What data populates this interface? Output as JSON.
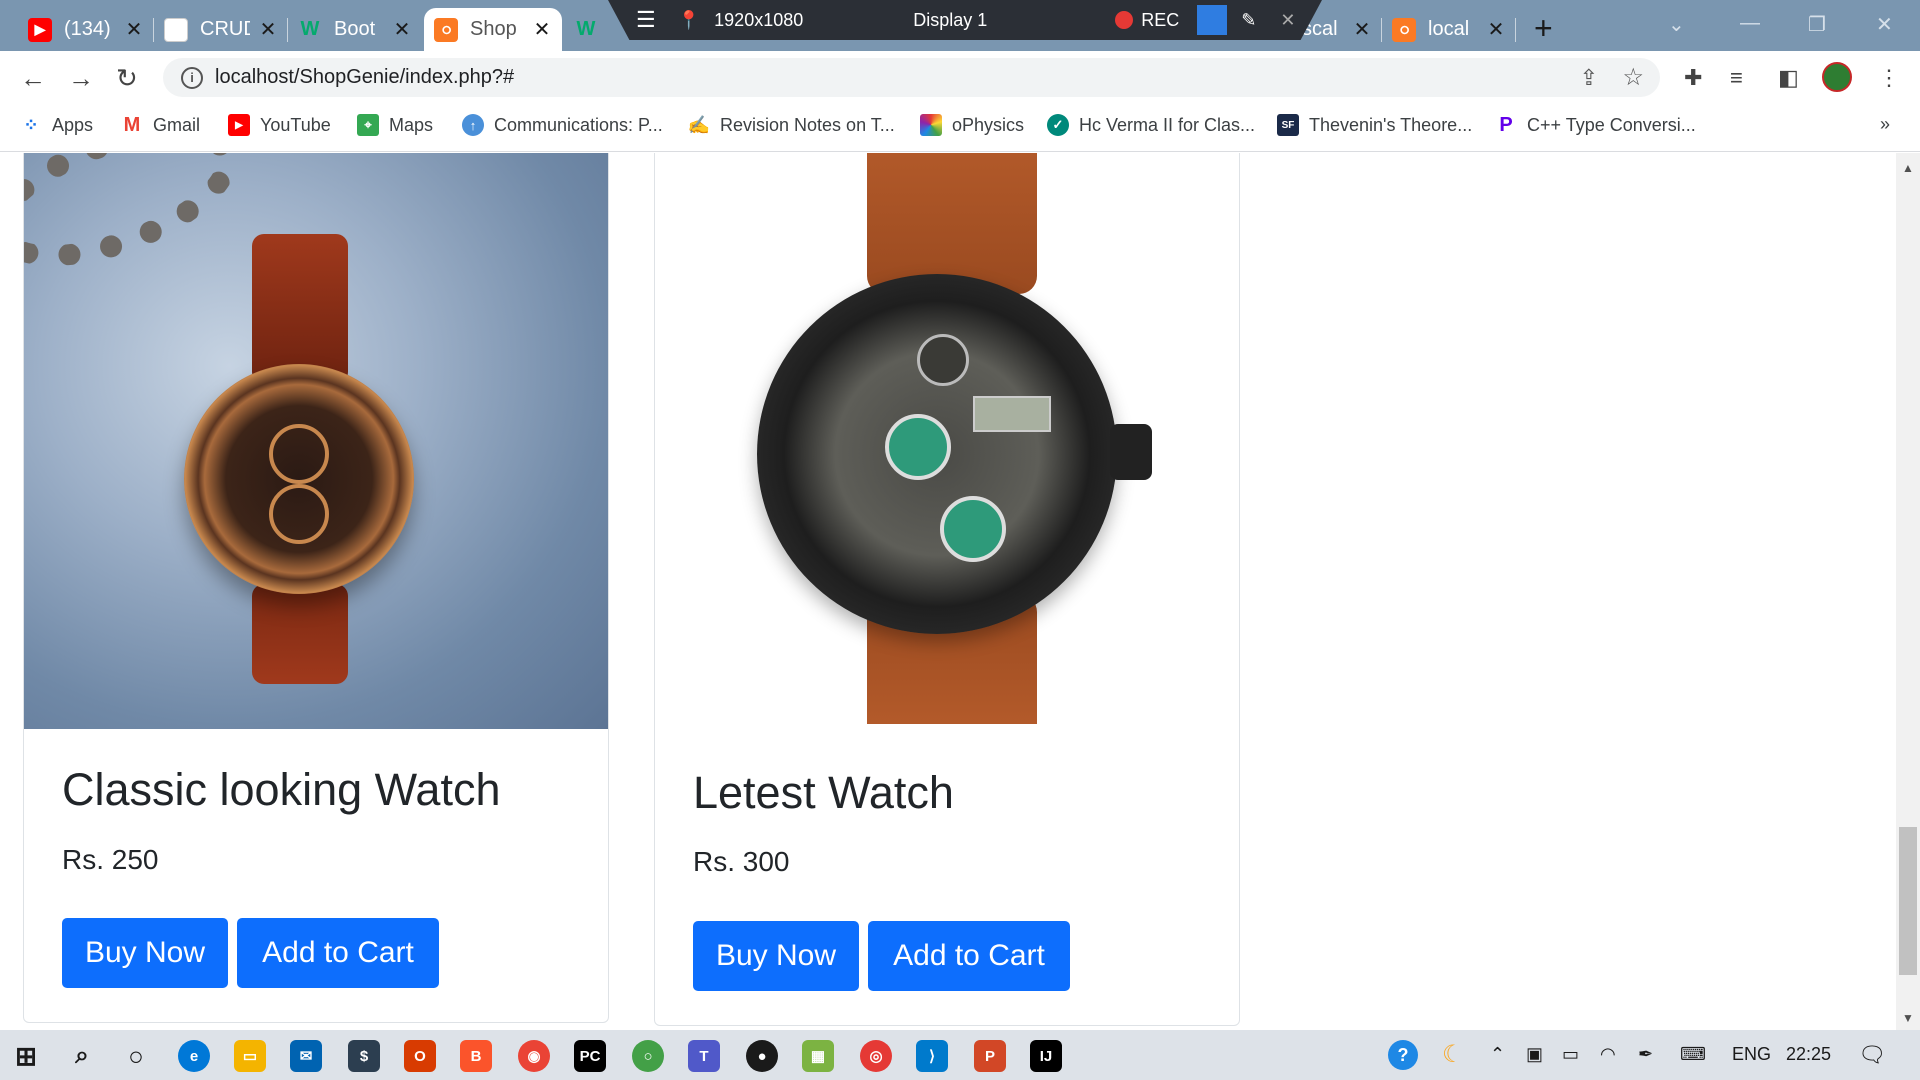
{
  "tabs": [
    {
      "title": "(134)",
      "icon": "youtube-icon",
      "color": "#ff0000"
    },
    {
      "title": "CRUD",
      "icon": "page-icon",
      "color": "#ffffff"
    },
    {
      "title": "Boot",
      "icon": "w3schools-icon",
      "color": "#04aa6d"
    },
    {
      "title": "Shop",
      "icon": "xampp-icon",
      "color": "#fb7a24",
      "active": true
    },
    {
      "title": "W",
      "icon": "w3schools-icon",
      "color": "#04aa6d"
    },
    {
      "title": "scal",
      "icon": "page-icon",
      "color": "#7a96b0"
    },
    {
      "title": "local",
      "icon": "xampp-icon",
      "color": "#fb7a24"
    }
  ],
  "recorder": {
    "resolution": "1920x1080",
    "display": "Display 1",
    "rec_label": "REC"
  },
  "toolbar": {
    "url": "localhost/ShopGenie/index.php?#"
  },
  "bookmarks": [
    {
      "label": "Apps",
      "icon": "apps-grid-icon",
      "color": "#1a73e8"
    },
    {
      "label": "Gmail",
      "icon": "gmail-icon",
      "color": "#ea4335"
    },
    {
      "label": "YouTube",
      "icon": "youtube-icon",
      "color": "#ff0000"
    },
    {
      "label": "Maps",
      "icon": "maps-icon",
      "color": "#34a853"
    },
    {
      "label": "Communications: P...",
      "icon": "upload-icon",
      "color": "#4a90d9"
    },
    {
      "label": "Revision Notes on T...",
      "icon": "notes-icon",
      "color": "#f57c00"
    },
    {
      "label": "oPhysics",
      "icon": "ophysics-icon",
      "color": "#8e24aa"
    },
    {
      "label": "Hc Verma II for Clas...",
      "icon": "book-icon",
      "color": "#00897b"
    },
    {
      "label": "Thevenin's Theore...",
      "icon": "sf-icon",
      "color": "#1b2a49"
    },
    {
      "label": "C++ Type Conversi...",
      "icon": "p-icon",
      "color": "#6200ea"
    }
  ],
  "products": [
    {
      "title": "Classic looking Watch",
      "price": "Rs. 250",
      "buy": "Buy Now",
      "cart": "Add to Cart"
    },
    {
      "title": "Letest Watch",
      "price": "Rs. 300",
      "buy": "Buy Now",
      "cart": "Add to Cart"
    }
  ],
  "taskbar": {
    "apps": [
      {
        "icon": "search-icon",
        "color": "#1a1a1a"
      },
      {
        "icon": "cortana-icon",
        "color": "#1a1a1a"
      },
      {
        "icon": "edge-icon",
        "color": "#0078d7"
      },
      {
        "icon": "file-explorer-icon",
        "color": "#f4b400"
      },
      {
        "icon": "mail-icon",
        "color": "#0063b1"
      },
      {
        "icon": "cash-app-icon",
        "color": "#2c3e50"
      },
      {
        "icon": "office-icon",
        "color": "#d83b01"
      },
      {
        "icon": "brave-icon",
        "color": "#fb542b"
      },
      {
        "icon": "chrome-icon",
        "color": "#ea4335"
      },
      {
        "icon": "pycharm-icon",
        "color": "#000000"
      },
      {
        "icon": "circle-app-icon",
        "color": "#43a047"
      },
      {
        "icon": "teams-icon",
        "color": "#5059c9"
      },
      {
        "icon": "record-icon",
        "color": "#1a1a1a"
      },
      {
        "icon": "grid-app-icon",
        "color": "#7cb342"
      },
      {
        "icon": "target-app-icon",
        "color": "#e53935"
      },
      {
        "icon": "vscode-icon",
        "color": "#007acc"
      },
      {
        "icon": "powerpoint-icon",
        "color": "#d24726"
      },
      {
        "icon": "intellij-icon",
        "color": "#000000"
      }
    ],
    "language": "ENG",
    "time": "22:25"
  }
}
